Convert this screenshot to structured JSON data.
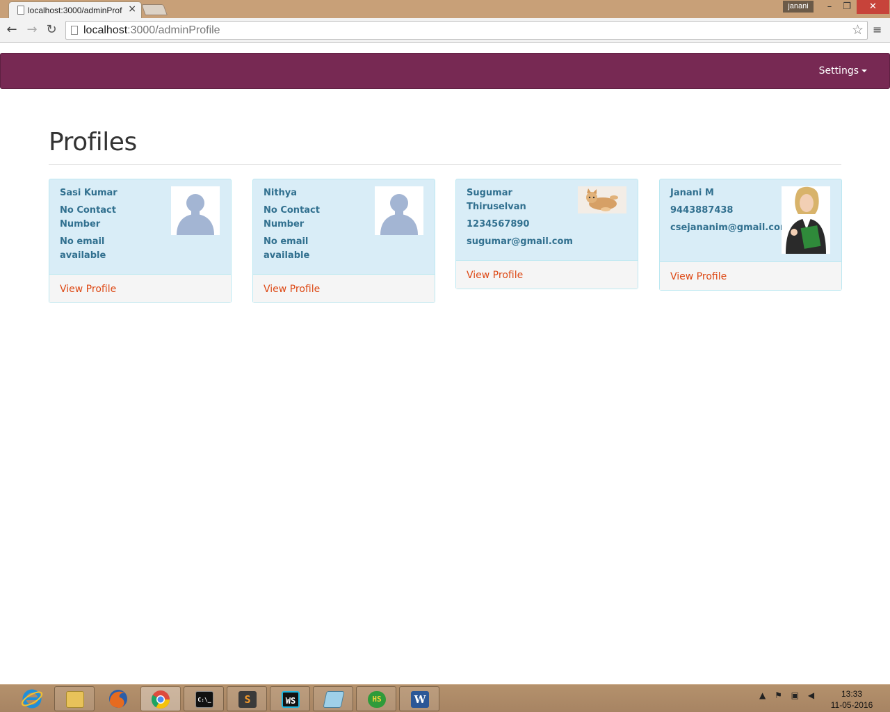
{
  "browser": {
    "tab_title": "localhost:3000/adminProf",
    "tab_close": "×",
    "user": "janani",
    "url_host": "localhost",
    "url_path": ":3000/adminProfile",
    "window_min": "–",
    "window_max": "❐",
    "window_close": "✕",
    "back": "←",
    "forward": "→",
    "reload": "↻",
    "star": "☆",
    "menu": "≡"
  },
  "navbar": {
    "settings_label": "Settings"
  },
  "page": {
    "title": "Profiles"
  },
  "profiles": [
    {
      "name": "Sasi Kumar",
      "contact": "No Contact Number",
      "email": "No email available",
      "link": "View Profile",
      "avatar": "default-silhouette"
    },
    {
      "name": "Nithya",
      "contact": "No Contact Number",
      "email": "No email available",
      "link": "View Profile",
      "avatar": "default-silhouette"
    },
    {
      "name": "Sugumar Thiruselvan",
      "contact": "1234567890",
      "email": "sugumar@gmail.com",
      "link": "View Profile",
      "avatar": "kitten-photo"
    },
    {
      "name": "Janani M",
      "contact": "9443887438",
      "email": "csejananim@gmail.com",
      "link": "View Profile",
      "avatar": "woman-photo"
    }
  ],
  "taskbar": {
    "items": [
      "internet-explorer",
      "file-explorer",
      "firefox",
      "chrome",
      "command-prompt",
      "sublime-text",
      "webstorm",
      "notepad",
      "heidisql",
      "word"
    ],
    "cmd_text": "C:\\_",
    "sublime_text": "S",
    "webstorm_text": "WS",
    "heidi_text": "HS",
    "word_text": "W",
    "time": "13:33",
    "date": "11-05-2016"
  },
  "colors": {
    "navbar": "#772953",
    "panel_bg": "#d9edf7",
    "panel_text": "#31708f",
    "link": "#dd4814"
  }
}
